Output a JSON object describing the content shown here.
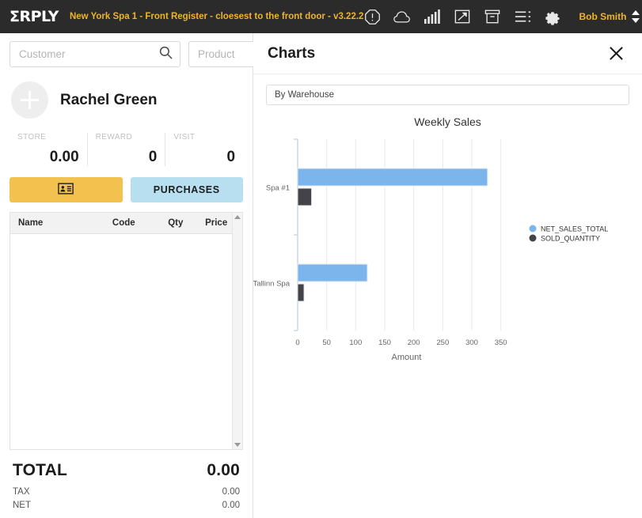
{
  "topbar": {
    "logo": "ΣRPLY",
    "store_label": "New York Spa 1 - Front Register - cloesest to the front door - v3.22.2",
    "user_name": "Bob Smith",
    "icons": [
      "alert-octagon-icon",
      "cloud-icon",
      "signal-bars-icon",
      "screen-expand-icon",
      "archive-box-icon",
      "list-menu-icon",
      "gear-icon"
    ],
    "accent_color": "#f0b429",
    "background_color": "#2b2b2b"
  },
  "left_panel": {
    "customer_search_placeholder": "Customer",
    "customer_search_value": "",
    "product_search_placeholder": "Product",
    "product_search_value": "",
    "customer_name": "Rachel Green",
    "stats": [
      {
        "label": "STORE",
        "value": "0.00"
      },
      {
        "label": "REWARD",
        "value": "0"
      },
      {
        "label": "VISIT",
        "value": "0"
      }
    ],
    "buttons": {
      "customer_card_label": "",
      "customer_card_icon": "id-card-icon",
      "purchases_label": "PURCHASES",
      "yellow_color": "#f2c14e",
      "blue_color": "#b8dff0"
    },
    "table": {
      "columns": [
        "Name",
        "Code",
        "Qty",
        "Price"
      ],
      "rows": []
    },
    "totals": {
      "total_label": "TOTAL",
      "total_value": "0.00",
      "tax_label": "TAX",
      "tax_value": "0.00",
      "net_label": "NET",
      "net_value": "0.00"
    }
  },
  "right_panel": {
    "title": "Charts",
    "close_icon": "close-icon",
    "grouping_dropdown_value": "By Warehouse"
  },
  "chart_data": {
    "type": "bar",
    "orientation": "horizontal",
    "title": "Weekly Sales",
    "xlabel": "Amount",
    "ylabel": "",
    "categories": [
      "Spa #1",
      "Tallinn Spa"
    ],
    "series": [
      {
        "name": "NET_SALES_TOTAL",
        "color": "#7cb5ec",
        "values": [
          327,
          120
        ]
      },
      {
        "name": "SOLD_QUANTITY",
        "color": "#434348",
        "values": [
          24,
          11
        ]
      }
    ],
    "xlim": [
      0,
      375
    ],
    "xticks": [
      0,
      50,
      100,
      150,
      200,
      250,
      300,
      350
    ],
    "xtick_labels": [
      "0",
      "50",
      "100",
      "150",
      "200",
      "250",
      "300",
      "350"
    ],
    "grid": true,
    "legend_position": "right"
  }
}
